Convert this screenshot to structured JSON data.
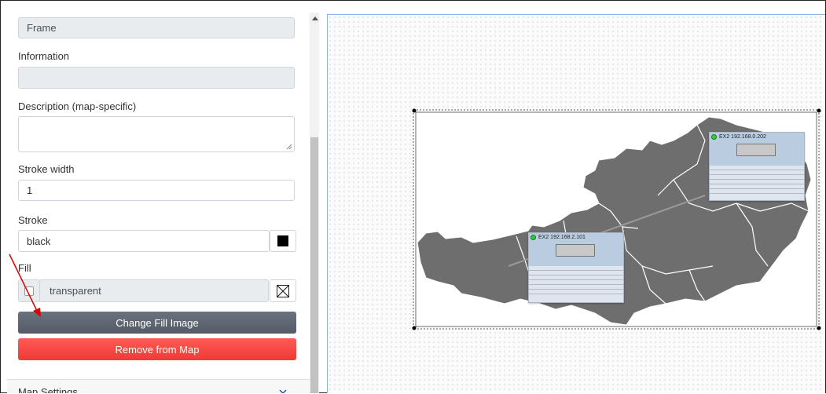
{
  "panel": {
    "frame_value": "Frame",
    "information_label": "Information",
    "information_value": "",
    "description_label": "Description (map-specific)",
    "description_value": "",
    "stroke_width_label": "Stroke width",
    "stroke_width_value": "1",
    "stroke_label": "Stroke",
    "stroke_value": "black",
    "fill_label": "Fill",
    "fill_value": "transparent",
    "change_fill_label": "Change Fill Image",
    "remove_label": "Remove from Map",
    "bottom_section_label": "Map Settings"
  },
  "map": {
    "device1_title": "EX2 192.168.0.202",
    "device2_title": "EX2 192.168.2.101"
  },
  "colors": {
    "change_fill": "#5a6270",
    "remove": "#f5433f",
    "map_fill": "#6e6e6e",
    "arrow": "#e00000"
  }
}
